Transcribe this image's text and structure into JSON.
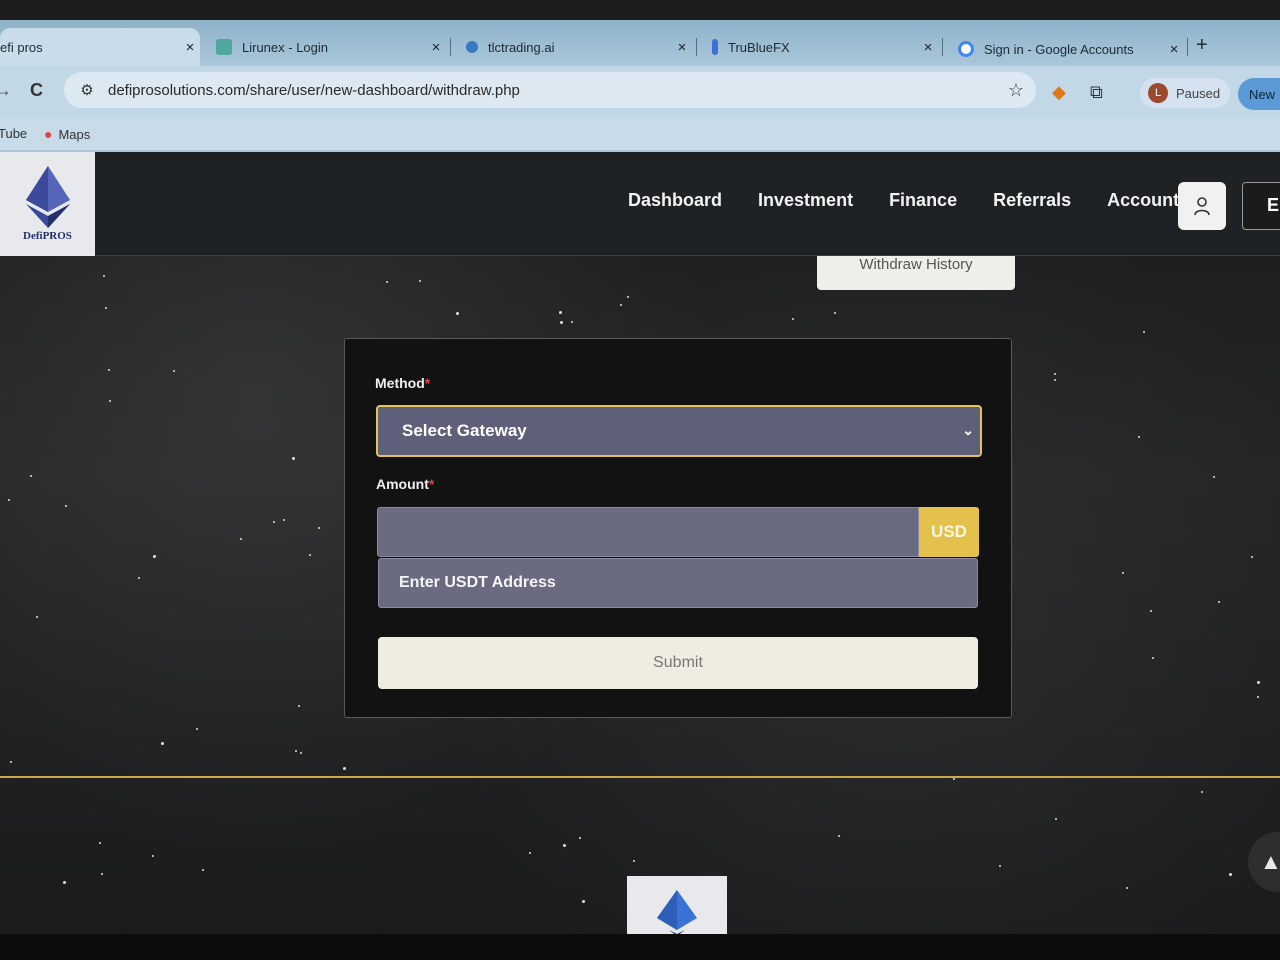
{
  "browser": {
    "tabs": [
      {
        "label": "efi pros",
        "close": "×"
      },
      {
        "label": "Lirunex - Login",
        "close": "×"
      },
      {
        "label": "tlctrading.ai",
        "close": "×"
      },
      {
        "label": "TruBlueFX",
        "close": "×"
      },
      {
        "label": "Sign in - Google Accounts",
        "close": "×"
      }
    ],
    "new_tab": "+",
    "back": "→",
    "reload": "C",
    "url": "defiprosolutions.com/share/user/new-dashboard/withdraw.php",
    "profile_initial": "L",
    "profile_status": "Paused",
    "new_chip": "New",
    "bookmarks": [
      {
        "label": "Tube"
      },
      {
        "label": "Maps"
      }
    ]
  },
  "site": {
    "logo_text": "DefiPROS",
    "nav": [
      "Dashboard",
      "Investment",
      "Finance",
      "Referrals",
      "Account"
    ],
    "extra_button": "E",
    "withdraw_history": "Withdraw History"
  },
  "form": {
    "method_label": "Method",
    "required_mark": "*",
    "gateway_placeholder": "Select Gateway",
    "amount_label": "Amount",
    "currency": "USD",
    "address_placeholder": "Enter USDT Address",
    "submit": "Submit"
  },
  "colors": {
    "accent_gold": "#e4c14d",
    "input_bg": "#6a6b80",
    "header_bg": "#1f2224"
  }
}
